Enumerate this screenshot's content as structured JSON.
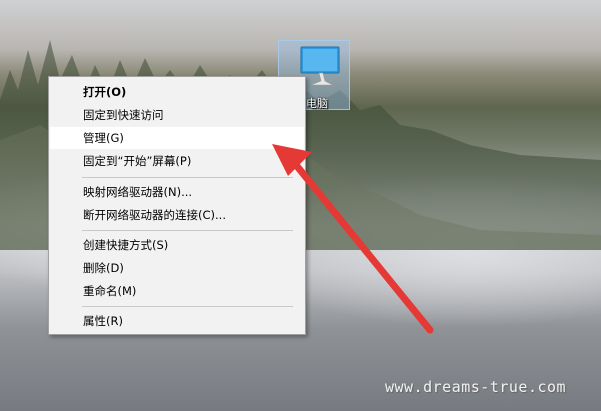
{
  "menu": {
    "items": [
      {
        "label": "打开(O)",
        "bold": true
      },
      {
        "label": "固定到快速访问"
      },
      {
        "label": "管理(G)",
        "highlighted": true
      },
      {
        "label": "固定到“开始”屏幕(P)"
      },
      {
        "label": "映射网络驱动器(N)..."
      },
      {
        "label": "断开网络驱动器的连接(C)..."
      },
      {
        "label": "创建快捷方式(S)"
      },
      {
        "label": "删除(D)"
      },
      {
        "label": "重命名(M)"
      },
      {
        "label": "属性(R)"
      }
    ]
  },
  "desktop_icon": {
    "label": "电脑",
    "icon": "computer-monitor-icon"
  },
  "annotation": {
    "icon": "red-arrow-icon",
    "color": "#e53935"
  },
  "watermark": "www.dreams-true.com",
  "colors": {
    "highlight": "#ffffff",
    "menu_bg": "#f2f2f2",
    "arrow": "#e53935",
    "selection": "#9cc4ea"
  }
}
